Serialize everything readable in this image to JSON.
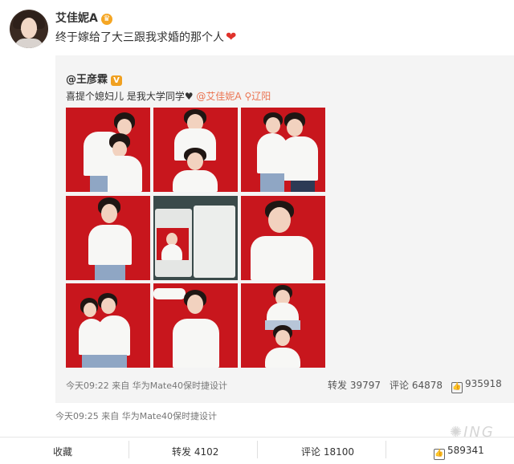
{
  "post": {
    "username": "艾佳妮A",
    "text": "终于嫁给了大三跟我求婚的那个人",
    "heart": "❤",
    "time": "今天09:25",
    "source_prefix": "来自",
    "source": "华为Mate40保时捷设计"
  },
  "repost": {
    "orig_user": "@王彦霖",
    "text_main": "喜提个媳妇儿 是我大学同学♥",
    "mention": "@艾佳妮A",
    "location": "辽阳",
    "time": "今天09:22",
    "source_prefix": "来自",
    "source": "华为Mate40保时捷设计",
    "forward": "转发 39797",
    "comment": "评论 64878",
    "likes": "935918"
  },
  "actions": {
    "favorite": "收藏",
    "forward": "转发 4102",
    "comment": "评论 18100",
    "likes": "589341"
  },
  "colors": {
    "accent": "#eb7350",
    "photo_bg": "#c8161d"
  }
}
